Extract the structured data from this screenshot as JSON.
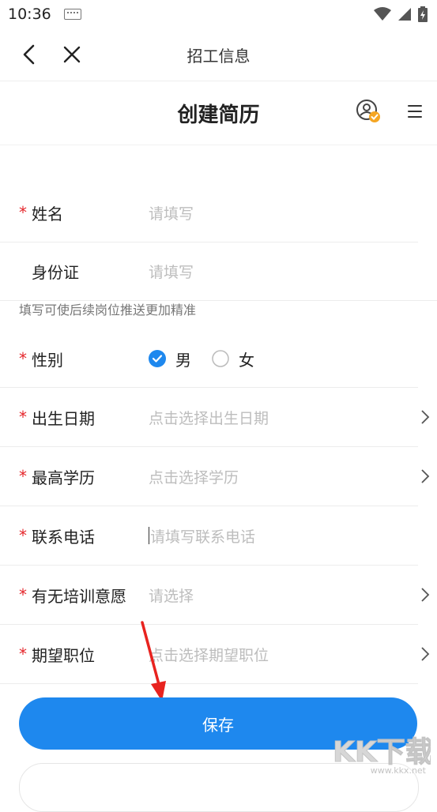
{
  "status_bar": {
    "time": "10:36"
  },
  "nav": {
    "title": "招工信息"
  },
  "header": {
    "title": "创建简历"
  },
  "form": {
    "name": {
      "label": "姓名",
      "placeholder": "请填写",
      "required": "*"
    },
    "id_card": {
      "label": "身份证",
      "placeholder": "请填写"
    },
    "hint": "填写可使后续岗位推送更加精准",
    "gender": {
      "label": "性别",
      "required": "*",
      "options": [
        "男",
        "女"
      ],
      "selected": "男"
    },
    "birthday": {
      "label": "出生日期",
      "placeholder": "点击选择出生日期",
      "required": "*"
    },
    "education": {
      "label": "最高学历",
      "placeholder": "点击选择学历",
      "required": "*"
    },
    "phone": {
      "label": "联系电话",
      "placeholder": "请填写联系电话",
      "required": "*"
    },
    "training": {
      "label": "有无培训意愿",
      "placeholder": "请选择",
      "required": "*"
    },
    "position": {
      "label": "期望职位",
      "placeholder": "点击选择期望职位",
      "required": "*"
    }
  },
  "save_button": {
    "label": "保存"
  },
  "watermark": {
    "text": "KK下载",
    "url": "www.kkx.net"
  },
  "colors": {
    "primary": "#1e88ee",
    "required": "#e5262b",
    "badge": "#f5a623"
  }
}
